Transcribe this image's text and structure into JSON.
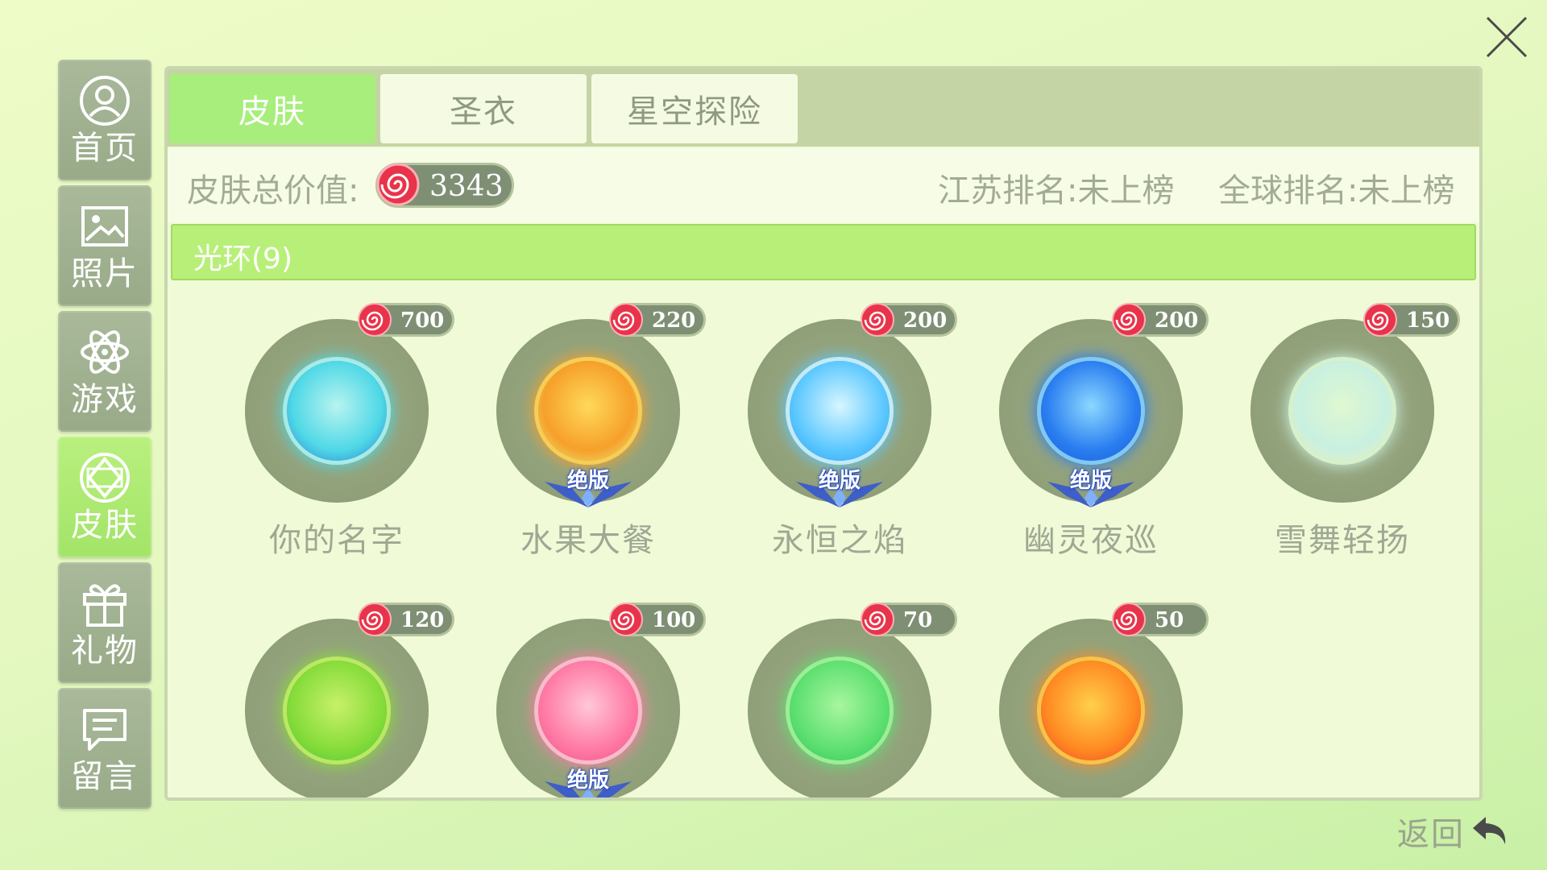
{
  "sidebar": {
    "items": [
      {
        "label": "首页",
        "icon": "user-icon",
        "active": false
      },
      {
        "label": "照片",
        "icon": "photo-icon",
        "active": false
      },
      {
        "label": "游戏",
        "icon": "atom-icon",
        "active": false
      },
      {
        "label": "皮肤",
        "icon": "gem-icon",
        "active": true
      },
      {
        "label": "礼物",
        "icon": "gift-icon",
        "active": false
      },
      {
        "label": "留言",
        "icon": "message-icon",
        "active": false
      }
    ]
  },
  "tabs": [
    {
      "label": "皮肤",
      "active": true
    },
    {
      "label": "圣衣",
      "active": false
    },
    {
      "label": "星空探险",
      "active": false
    }
  ],
  "summary": {
    "total_label": "皮肤总价值:",
    "total_value": "3343",
    "province_rank": "江苏排名:未上榜",
    "global_rank": "全球排名:未上榜"
  },
  "category": {
    "label": "光环(9)"
  },
  "badge_text": "绝版",
  "items": [
    {
      "name": "你的名字",
      "price": "700",
      "limited": false,
      "colors": [
        "#b8f4f0",
        "#4fd8e6",
        "#2a78d8"
      ]
    },
    {
      "name": "水果大餐",
      "price": "220",
      "limited": true,
      "colors": [
        "#ffd95a",
        "#f6a02a",
        "#e8f080"
      ]
    },
    {
      "name": "永恒之焰",
      "price": "200",
      "limited": true,
      "colors": [
        "#d8f6ff",
        "#5cc8ff",
        "#2a9cf0"
      ]
    },
    {
      "name": "幽灵夜巡",
      "price": "200",
      "limited": true,
      "colors": [
        "#8cd8ff",
        "#2a7ef0",
        "#1a58d8"
      ]
    },
    {
      "name": "雪舞轻扬",
      "price": "150",
      "limited": false,
      "colors": [
        "#dff8d0",
        "#c8f0e0",
        "#f4f0b0"
      ]
    },
    {
      "name": "",
      "price": "120",
      "limited": false,
      "colors": [
        "#c8f06a",
        "#86dc3a",
        "#4ec43a"
      ]
    },
    {
      "name": "",
      "price": "100",
      "limited": true,
      "colors": [
        "#ffc8d8",
        "#ff7aa4",
        "#f0508a"
      ]
    },
    {
      "name": "",
      "price": "70",
      "limited": false,
      "colors": [
        "#a8f6a0",
        "#5ee070",
        "#2ec460"
      ]
    },
    {
      "name": "",
      "price": "50",
      "limited": false,
      "colors": [
        "#ffd04a",
        "#ff8a22",
        "#f0402a"
      ]
    }
  ],
  "footer": {
    "back_label": "返回"
  },
  "colors": {
    "accent_green": "#a8ee7c",
    "coin_red": "#e8344a",
    "pill_dark": "#7f8f74"
  }
}
